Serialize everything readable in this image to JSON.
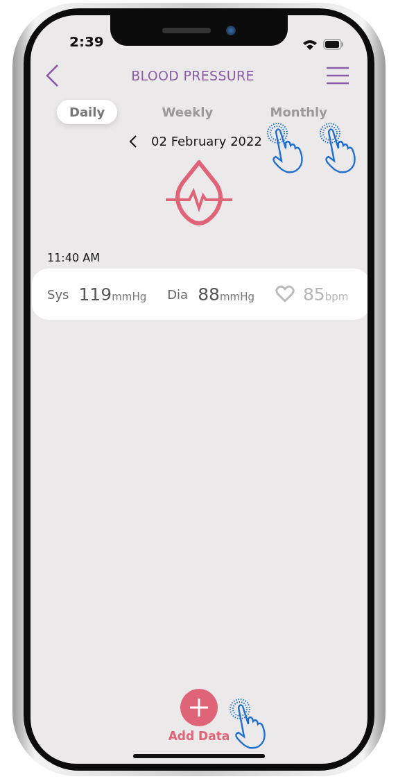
{
  "status_bar": {
    "time": "2:39"
  },
  "header": {
    "title": "BLOOD PRESSURE"
  },
  "tabs": [
    {
      "label": "Daily",
      "selected": true
    },
    {
      "label": "Weekly",
      "selected": false
    },
    {
      "label": "Monthly",
      "selected": false
    }
  ],
  "date": "02 February 2022",
  "reading": {
    "time": "11:40 AM",
    "sys_label": "Sys",
    "sys_value": "119",
    "sys_unit": "mmHg",
    "dia_label": "Dia",
    "dia_value": "88",
    "dia_unit": "mmHg",
    "pulse_value": "85",
    "pulse_unit": "bpm"
  },
  "add_button": {
    "label": "Add Data"
  }
}
